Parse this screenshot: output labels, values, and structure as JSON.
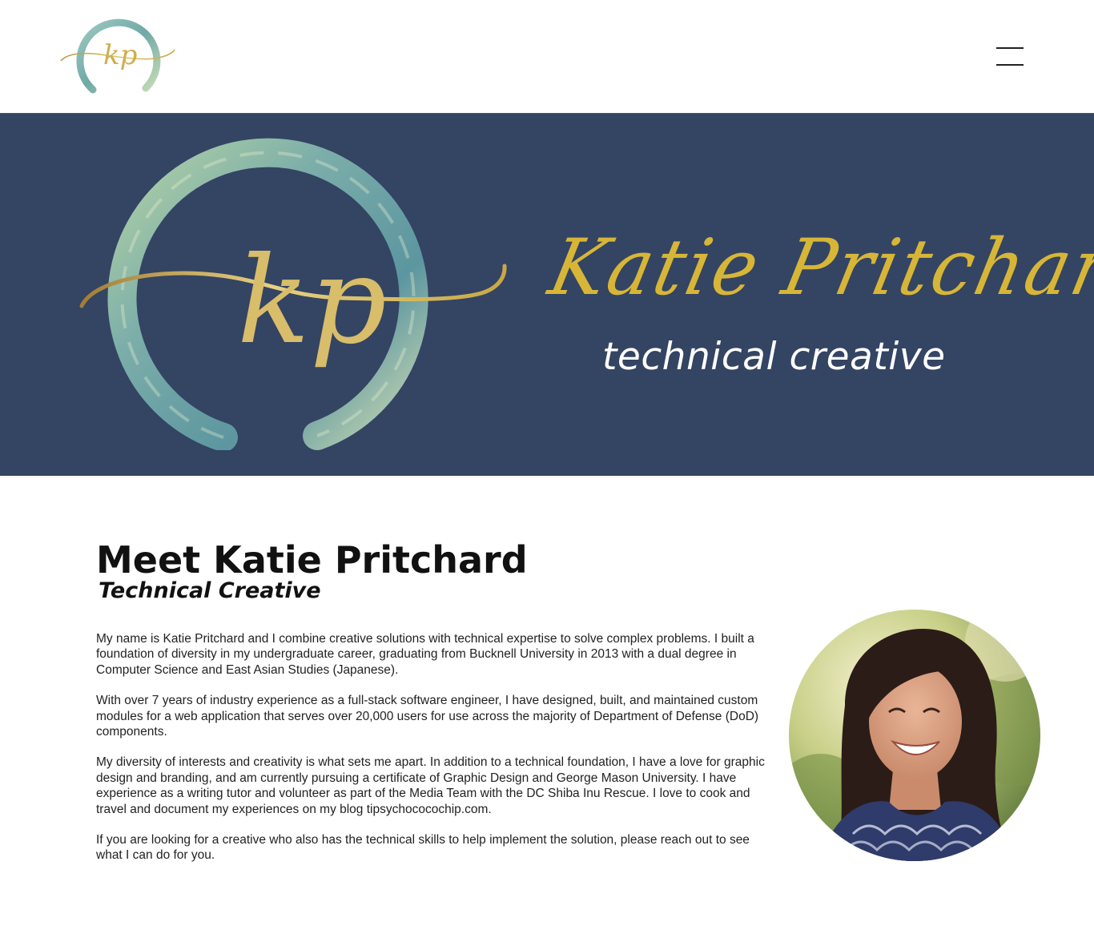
{
  "header": {
    "logo_monogram": "kp",
    "menu_icon": "hamburger-menu-icon"
  },
  "banner": {
    "monogram": "kp",
    "name": "Katie Pritchard",
    "tagline": "technical creative",
    "colors": {
      "background": "#344463",
      "gold": "#d7b637",
      "teal": "#7fb3ad",
      "tagline": "#ffffff"
    }
  },
  "about": {
    "title": "Meet Katie Pritchard",
    "subtitle": "Technical Creative",
    "paragraphs": [
      "My name is Katie Pritchard and I combine creative solutions with technical expertise to solve complex problems.  I built a foundation of diversity in my undergraduate career, graduating from Bucknell University in 2013 with a dual degree in Computer Science and East Asian Studies (Japanese).",
      "With over 7 years of industry experience as a full-stack software engineer, I have designed, built, and maintained custom modules for a web application that serves over 20,000 users for use across the majority of Department of Defense (DoD) components.",
      "My diversity of interests and creativity is what sets me apart.  In addition to a technical foundation, I have a love for graphic design and branding, and am currently pursuing a certificate of Graphic Design and George Mason University.  I have experience as a writing tutor and volunteer as part of the Media Team with the DC Shiba Inu Rescue.  I love to cook and travel and document my experiences on my blog tipsychococochip.com.",
      "If you are looking for a creative who also has the technical skills to help implement the solution, please reach out to see what I can do for you."
    ],
    "portrait": "portrait-photo"
  }
}
